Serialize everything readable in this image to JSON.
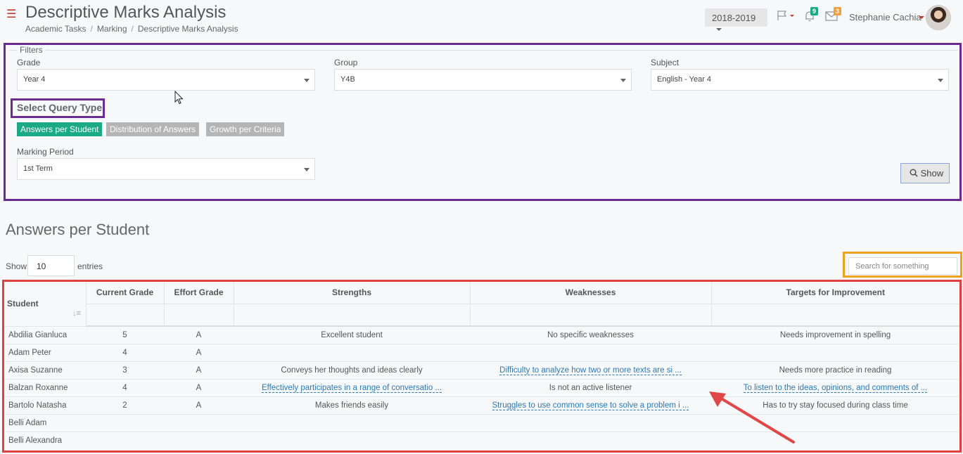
{
  "header": {
    "title": "Descriptive Marks Analysis",
    "breadcrumb": [
      "Academic Tasks",
      "Marking",
      "Descriptive Marks Analysis"
    ],
    "year": "2018-2019",
    "notifications_count": "9",
    "messages_count": "3",
    "user_name": "Stephanie Cachia"
  },
  "filters": {
    "legend": "Filters",
    "grade_label": "Grade",
    "grade_value": "Year 4",
    "group_label": "Group",
    "group_value": "Y4B",
    "subject_label": "Subject",
    "subject_value": "English - Year 4",
    "query_type_label": "Select Query Type",
    "query_types": [
      "Answers per Student",
      "Distribution of Answers",
      "Growth per Criteria"
    ],
    "marking_period_label": "Marking Period",
    "marking_period_value": "1st Term",
    "show_label": "Show"
  },
  "table_section": {
    "title": "Answers per Student",
    "show_label": "Show",
    "entries_value": "10",
    "entries_label": "entries",
    "search_placeholder": "Search for something",
    "columns": [
      "Student",
      "Current Grade",
      "Effort Grade",
      "Strengths",
      "Weaknesses",
      "Targets for Improvement"
    ],
    "rows": [
      [
        "Abdilia Gianluca",
        "5",
        "A",
        "Excellent student",
        "No specific weaknesses",
        "Needs improvement in spelling"
      ],
      [
        "Adam Peter",
        "4",
        "A",
        "",
        "",
        ""
      ],
      [
        "Axisa Suzanne",
        "3",
        "A",
        "Conveys her thoughts and ideas clearly",
        "Difficulty to analyze how two or more texts are si ...",
        "Needs more practice in reading"
      ],
      [
        "Balzan Roxanne",
        "4",
        "A",
        "Effectively participates in a range of conversatio ...",
        "Is not an active listener",
        "To listen to the ideas, opinions, and comments of ..."
      ],
      [
        "Bartolo Natasha",
        "2",
        "A",
        "Makes friends easily",
        "Struggles to use common sense to solve a problem i ...",
        "Has to try stay focused during class time"
      ],
      [
        "Belli Adam",
        "",
        "",
        "",
        "",
        ""
      ],
      [
        "Belli Alexandra",
        "",
        "",
        "",
        "",
        ""
      ]
    ],
    "truncated_cells": [
      [
        2,
        4
      ],
      [
        3,
        3
      ],
      [
        3,
        5
      ],
      [
        4,
        4
      ]
    ]
  },
  "colors": {
    "accent_green": "#1aaa86",
    "inactive_button": "#b5b5b5",
    "link_blue": "#2a7ab8",
    "highlight_purple": "#6a2c91",
    "highlight_orange": "#f0a020",
    "highlight_red": "#e04040"
  }
}
